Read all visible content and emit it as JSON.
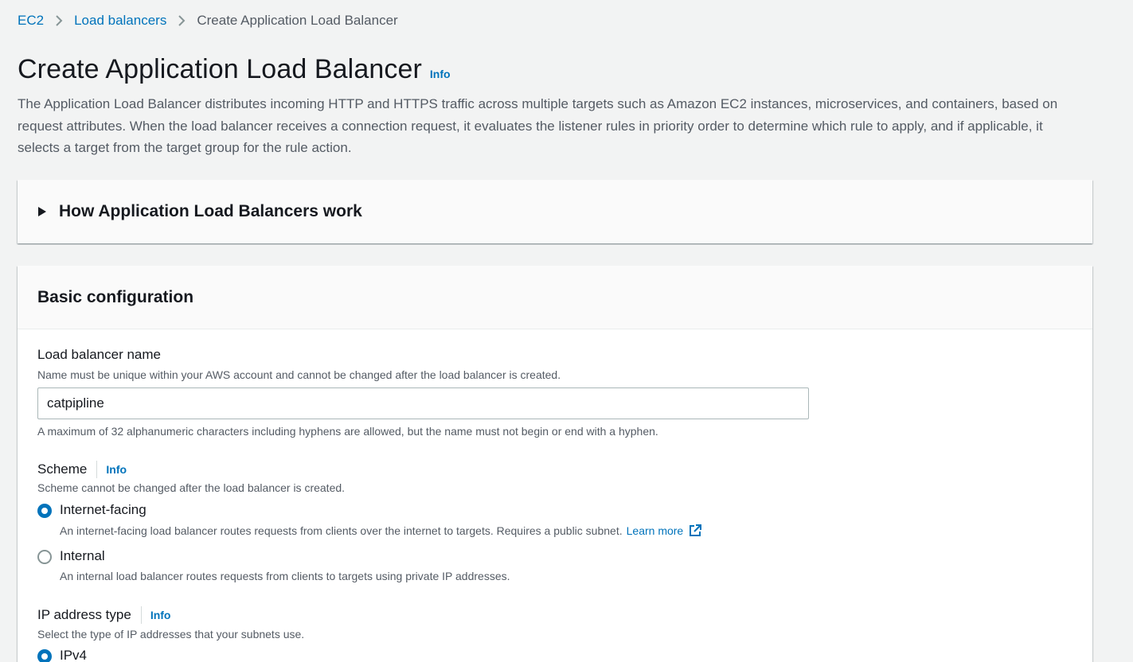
{
  "breadcrumb": {
    "items": [
      "EC2",
      "Load balancers"
    ],
    "current": "Create Application Load Balancer"
  },
  "header": {
    "title": "Create Application Load Balancer",
    "info": "Info",
    "description": "The Application Load Balancer distributes incoming HTTP and HTTPS traffic across multiple targets such as Amazon EC2 instances, microservices, and containers, based on request attributes. When the load balancer receives a connection request, it evaluates the listener rules in priority order to determine which rule to apply, and if applicable, it selects a target from the target group for the rule action."
  },
  "expandable": {
    "title": "How Application Load Balancers work",
    "expanded": false
  },
  "basic_config": {
    "title": "Basic configuration",
    "name_field": {
      "label": "Load balancer name",
      "description": "Name must be unique within your AWS account and cannot be changed after the load balancer is created.",
      "value": "catpipline",
      "constraint": "A maximum of 32 alphanumeric characters including hyphens are allowed, but the name must not begin or end with a hyphen."
    },
    "scheme": {
      "label": "Scheme",
      "info": "Info",
      "description": "Scheme cannot be changed after the load balancer is created.",
      "options": [
        {
          "label": "Internet-facing",
          "description": "An internet-facing load balancer routes requests from clients over the internet to targets. Requires a public subnet.",
          "link": "Learn more",
          "selected": true
        },
        {
          "label": "Internal",
          "description": "An internal load balancer routes requests from clients to targets using private IP addresses.",
          "selected": false
        }
      ]
    },
    "ip_address_type": {
      "label": "IP address type",
      "info": "Info",
      "description": "Select the type of IP addresses that your subnets use.",
      "options": [
        {
          "label": "IPv4",
          "selected": true
        }
      ]
    }
  },
  "colors": {
    "link": "#0073bb",
    "background": "#f2f3f3",
    "text": "#16191f",
    "secondary_text": "#545b64"
  }
}
